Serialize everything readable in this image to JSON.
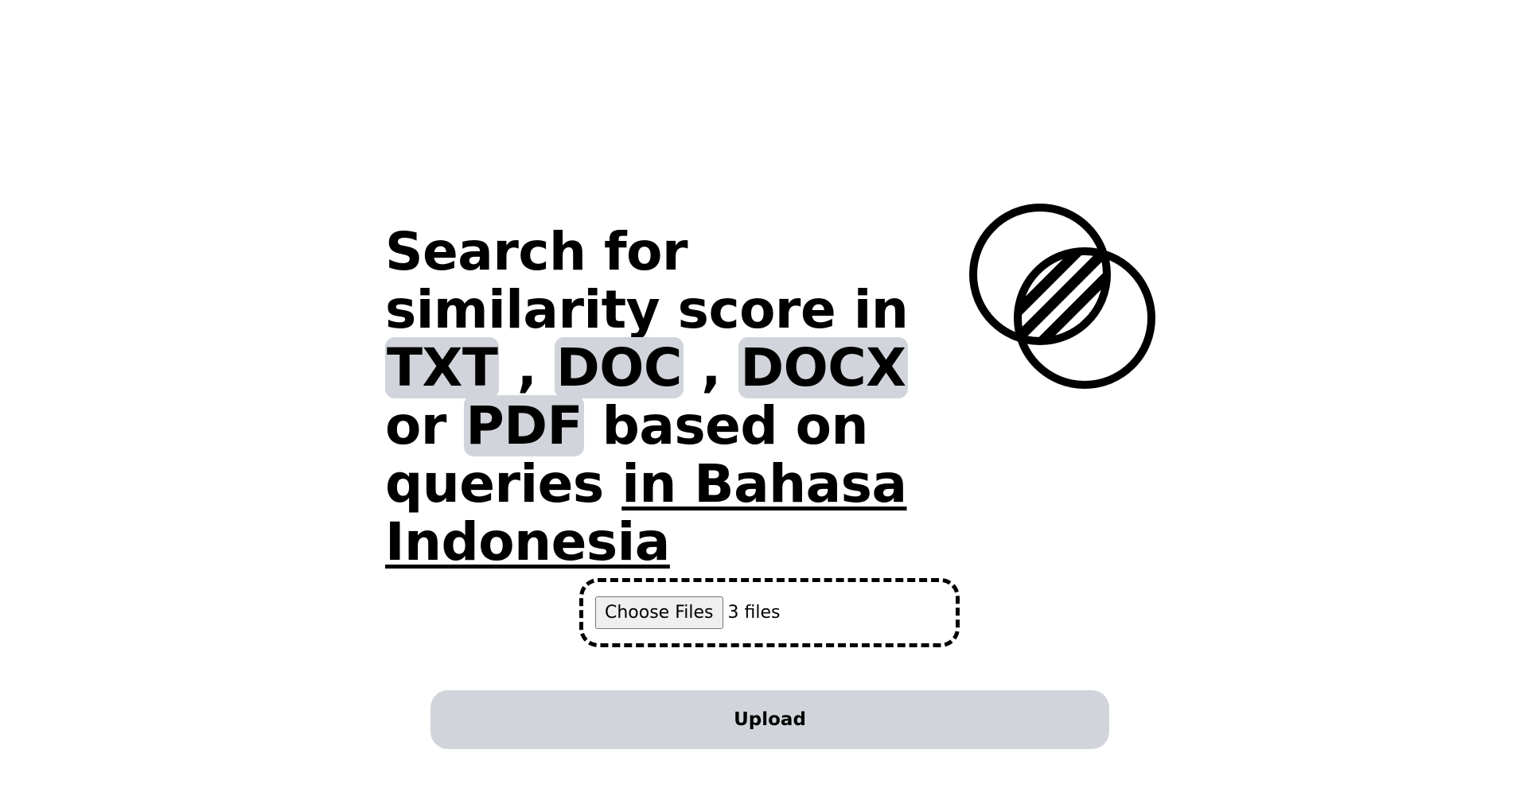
{
  "headline": {
    "part1": "Search for similarity score in ",
    "chip_txt": "TXT",
    "sep1": " , ",
    "chip_doc": "DOC",
    "sep2": " , ",
    "chip_docx": "DOCX",
    "sep3": " or ",
    "chip_pdf": "PDF",
    "part2": " based on queries ",
    "underlined": "in Bahasa Indonesia"
  },
  "logo": {
    "icon": "venn-diagram-icon"
  },
  "file_input": {
    "button_label": "Choose Files",
    "status": "3 files"
  },
  "upload": {
    "label": "Upload"
  },
  "colors": {
    "chip_background": "#d1d5db",
    "button_background": "#d1d5db",
    "text": "#000000",
    "background": "#ffffff"
  }
}
